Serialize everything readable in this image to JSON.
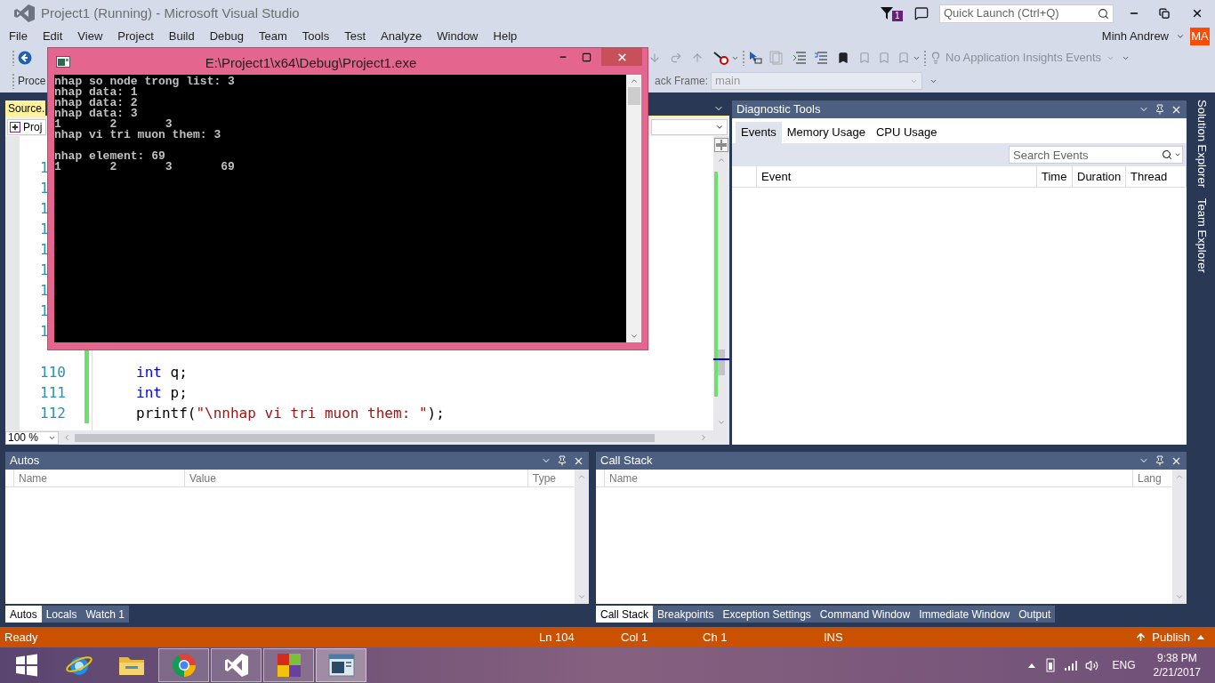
{
  "window": {
    "title": "Project1 (Running) - Microsoft Visual Studio"
  },
  "notifications": {
    "count": "1"
  },
  "quick_launch": {
    "placeholder": "Quick Launch (Ctrl+Q)"
  },
  "menu": [
    "File",
    "Edit",
    "View",
    "Project",
    "Build",
    "Debug",
    "Team",
    "Tools",
    "Test",
    "Analyze",
    "Window",
    "Help"
  ],
  "account": {
    "name": "Minh Andrew",
    "initials": "MA"
  },
  "toolbar": {
    "process_label": "Proce",
    "stack_frame_label": "ack Frame:",
    "stack_frame_value": "main",
    "insights": "No Application Insights Events"
  },
  "editor": {
    "tab": "Source.",
    "nav": "Proj",
    "zoom": "100 %",
    "covered_line_numbers": [
      "1",
      "1",
      "1",
      "1",
      "1",
      "1",
      "1",
      "1",
      "1"
    ],
    "lines": [
      {
        "number": "110",
        "code": [
          {
            "text": "int",
            "kind": "keyword"
          },
          {
            "text": " q;",
            "kind": "plain"
          }
        ]
      },
      {
        "number": "111",
        "code": [
          {
            "text": "int",
            "kind": "keyword"
          },
          {
            "text": " p;",
            "kind": "plain"
          }
        ]
      },
      {
        "number": "112",
        "code": [
          {
            "text": "printf(",
            "kind": "plain"
          },
          {
            "text": "\"\\nnhap vi tri muon them: \"",
            "kind": "string"
          },
          {
            "text": ");",
            "kind": "plain"
          }
        ]
      }
    ]
  },
  "console": {
    "title": "E:\\Project1\\x64\\Debug\\Project1.exe",
    "blocks": [
      [
        "nhap so node trong list: 3",
        "nhap data: 1",
        "nhap data: 2",
        "nhap data: 3",
        "1       2       3",
        "nhap vi tri muon them: 3"
      ],
      [
        "nhap element: 69",
        "1       2       3       69"
      ]
    ]
  },
  "diagnostics": {
    "title": "Diagnostic Tools",
    "tabs": [
      {
        "label": "Events",
        "selected": true
      },
      {
        "label": "Memory Usage",
        "selected": false
      },
      {
        "label": "CPU Usage",
        "selected": false
      }
    ],
    "search": {
      "placeholder": "Search Events"
    },
    "columns": [
      "Event",
      "Time",
      "Duration",
      "Thread"
    ]
  },
  "side_tabs": [
    "Solution Explorer",
    "Team Explorer"
  ],
  "autos": {
    "title": "Autos",
    "columns": [
      "Name",
      "Value",
      "Type"
    ],
    "tabs": [
      {
        "label": "Autos",
        "selected": true
      },
      {
        "label": "Locals",
        "selected": false
      },
      {
        "label": "Watch 1",
        "selected": false
      }
    ]
  },
  "call_stack": {
    "title": "Call Stack",
    "columns": [
      "Name",
      "Lang"
    ],
    "tabs": [
      {
        "label": "Call Stack",
        "selected": true
      },
      {
        "label": "Breakpoints",
        "selected": false
      },
      {
        "label": "Exception Settings",
        "selected": false
      },
      {
        "label": "Command Window",
        "selected": false
      },
      {
        "label": "Immediate Window",
        "selected": false
      },
      {
        "label": "Output",
        "selected": false
      }
    ]
  },
  "status_bar": {
    "state": "Ready",
    "line": "Ln 104",
    "col": "Col 1",
    "ch": "Ch 1",
    "mode": "INS",
    "publish": "Publish"
  },
  "taskbar": {
    "apps": [
      {
        "kind": "start",
        "running": false,
        "selected": false
      },
      {
        "kind": "browser-e",
        "running": false,
        "selected": false
      },
      {
        "kind": "folder",
        "running": false,
        "selected": false
      },
      {
        "kind": "chrome",
        "running": true,
        "selected": false
      },
      {
        "kind": "studio",
        "running": true,
        "selected": false
      },
      {
        "kind": "blocks",
        "running": true,
        "selected": false
      },
      {
        "kind": "console",
        "running": true,
        "selected": true
      }
    ],
    "language": "ENG",
    "time": "9:38 PM",
    "date": "2/21/2017"
  }
}
